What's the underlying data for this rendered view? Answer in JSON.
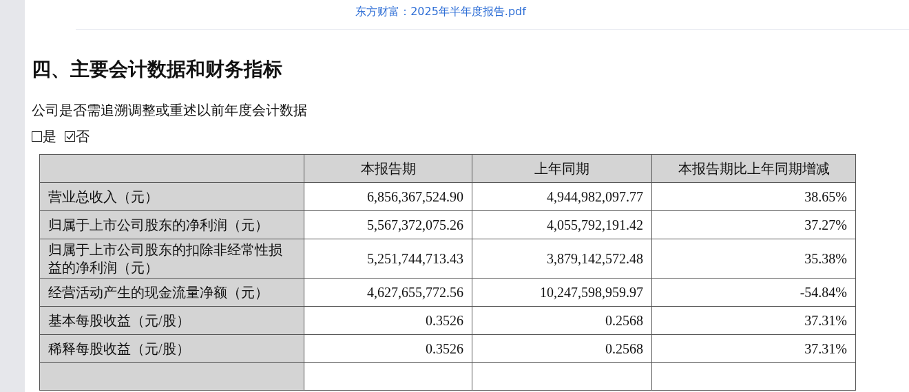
{
  "header": {
    "title": "东方财富：2025年半年度报告.pdf"
  },
  "section": {
    "heading": "四、主要会计数据和财务指标",
    "question": "公司是否需追溯调整或重述以前年度会计数据",
    "options": [
      {
        "label": "是",
        "checked": false
      },
      {
        "label": "否",
        "checked": true
      }
    ]
  },
  "table": {
    "columns": [
      "本报告期",
      "上年同期",
      "本报告期比上年同期增减"
    ],
    "rows": [
      {
        "label": "营业总收入（元）",
        "cells": [
          "6,856,367,524.90",
          "4,944,982,097.77",
          "38.65%"
        ]
      },
      {
        "label": "归属于上市公司股东的净利润（元）",
        "cells": [
          "5,567,372,075.26",
          "4,055,792,191.42",
          "37.27%"
        ]
      },
      {
        "label": "归属于上市公司股东的扣除非经常性损益的净利润（元）",
        "cells": [
          "5,251,744,713.43",
          "3,879,142,572.48",
          "35.38%"
        ]
      },
      {
        "label": "经营活动产生的现金流量净额（元）",
        "cells": [
          "4,627,655,772.56",
          "10,247,598,959.97",
          "-54.84%"
        ]
      },
      {
        "label": "基本每股收益（元/股）",
        "cells": [
          "0.3526",
          "0.2568",
          "37.31%"
        ]
      },
      {
        "label": "稀释每股收益（元/股）",
        "cells": [
          "0.3526",
          "0.2568",
          "37.31%"
        ]
      }
    ]
  }
}
